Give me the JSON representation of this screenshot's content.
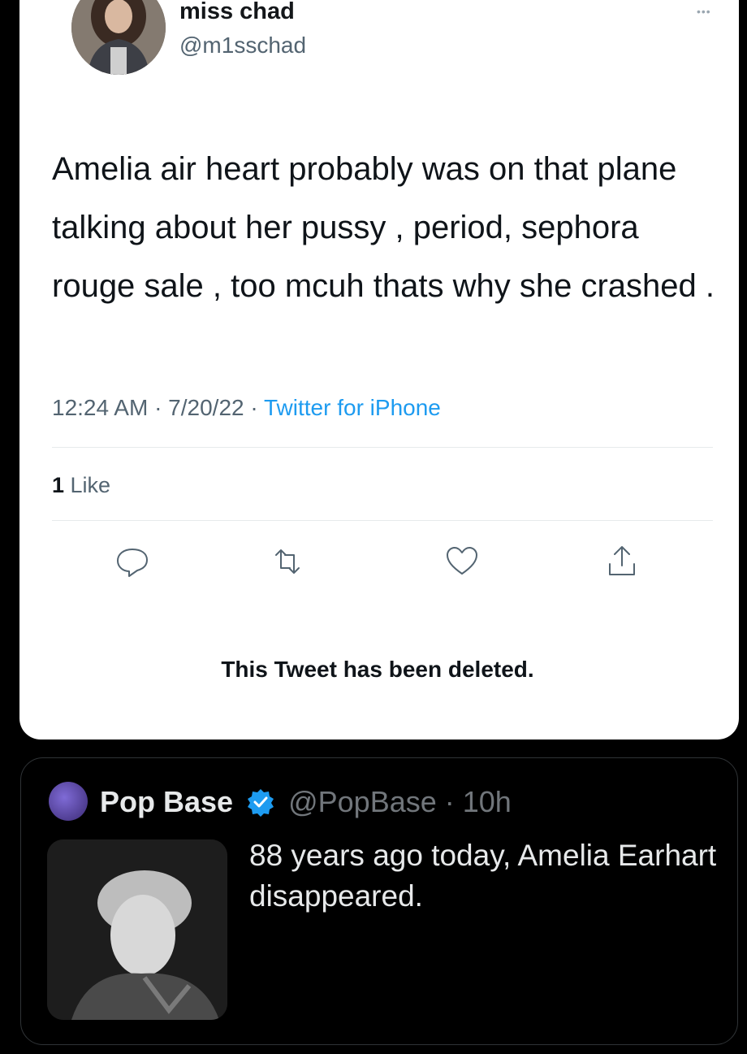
{
  "tweet": {
    "display_name": "miss chad",
    "handle": "@m1sschad",
    "more_icon": "•••",
    "text": "Amelia air heart probably was on that plane talking about her pussy , period, sephora rouge sale , too mcuh thats why she crashed .",
    "time": "12:24 AM · 7/20/22 · ",
    "source": "Twitter for iPhone",
    "likes_count": "1",
    "likes_label": " Like",
    "actions": [
      "reply-icon",
      "retweet-icon",
      "like-icon",
      "share-icon"
    ]
  },
  "deleted_notice": "This Tweet has been deleted.",
  "quote": {
    "name": "Pop Base",
    "handle": "@PopBase · 10h",
    "text": "88 years ago today, Amelia Earhart disappeared.",
    "verified_color": "#1d9bf0"
  }
}
